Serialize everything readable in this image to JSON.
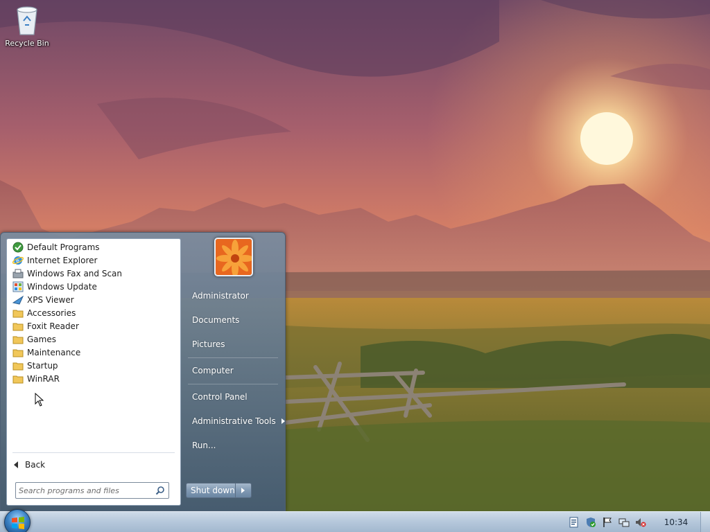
{
  "desktop": {
    "icons": [
      {
        "label": "Recycle Bin",
        "icon": "recycle-bin-icon"
      }
    ]
  },
  "start_menu": {
    "programs": [
      {
        "label": "Default Programs",
        "icon": "default-programs-icon"
      },
      {
        "label": "Internet Explorer",
        "icon": "internet-explorer-icon"
      },
      {
        "label": "Windows Fax and Scan",
        "icon": "fax-scan-icon"
      },
      {
        "label": "Windows Update",
        "icon": "windows-update-icon"
      },
      {
        "label": "XPS Viewer",
        "icon": "xps-viewer-icon"
      },
      {
        "label": "Accessories",
        "icon": "folder-icon"
      },
      {
        "label": "Foxit Reader",
        "icon": "folder-icon"
      },
      {
        "label": "Games",
        "icon": "folder-icon"
      },
      {
        "label": "Maintenance",
        "icon": "folder-icon"
      },
      {
        "label": "Startup",
        "icon": "folder-icon"
      },
      {
        "label": "WinRAR",
        "icon": "folder-icon"
      }
    ],
    "back_label": "Back",
    "search": {
      "placeholder": "Search programs and files",
      "value": ""
    },
    "user_tile_icon": "flower-user-icon",
    "right_items": [
      {
        "label": "Administrator"
      },
      {
        "label": "Documents"
      },
      {
        "label": "Pictures"
      },
      {
        "label": "Computer"
      },
      {
        "label": "Control Panel"
      },
      {
        "label": "Administrative Tools",
        "has_submenu": true
      },
      {
        "label": "Run..."
      }
    ],
    "shutdown_label": "Shut down"
  },
  "taskbar": {
    "start_icon": "windows-logo-icon",
    "tray_icons": [
      "action-center-flag-icon",
      "security-shield-icon",
      "flag-icon",
      "network-icon",
      "volume-muted-icon"
    ],
    "clock": "10:34"
  },
  "colors": {
    "menu_bg": "#6b86a3",
    "taskbar_bg": "#b7c9dc",
    "sky_top": "#7d4f6e",
    "sun": "#fff3c4"
  }
}
